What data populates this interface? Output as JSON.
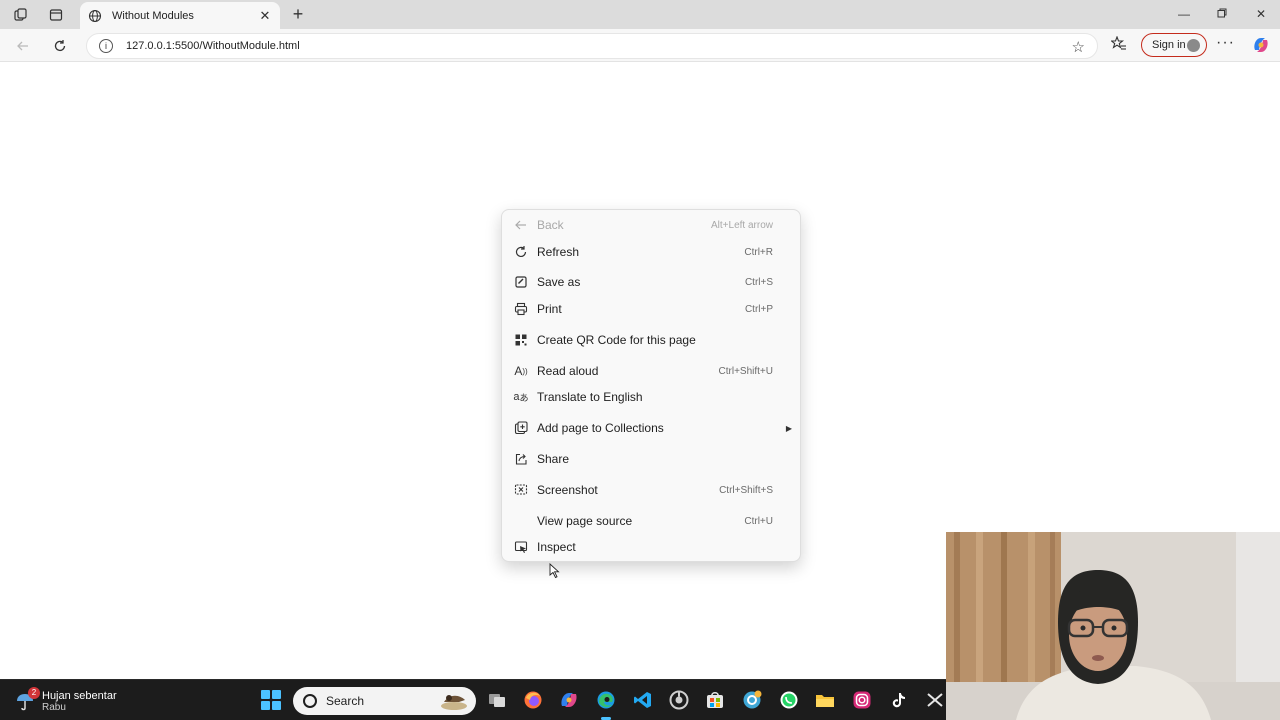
{
  "browser": {
    "tab": {
      "title": "Without Modules"
    },
    "address_bar": {
      "url": "127.0.0.1:5500/WithoutModule.html"
    },
    "sign_in_label": "Sign in"
  },
  "context_menu": {
    "items": [
      {
        "icon": "arrow-left-icon",
        "label": "Back",
        "shortcut": "Alt+Left arrow",
        "enabled": false
      },
      {
        "icon": "refresh-icon",
        "label": "Refresh",
        "shortcut": "Ctrl+R",
        "enabled": true
      },
      {
        "icon": "save-as-icon",
        "label": "Save as",
        "shortcut": "Ctrl+S",
        "enabled": true
      },
      {
        "icon": "print-icon",
        "label": "Print",
        "shortcut": "Ctrl+P",
        "enabled": true
      },
      {
        "icon": "qr-code-icon",
        "label": "Create QR Code for this page",
        "shortcut": "",
        "enabled": true
      },
      {
        "icon": "read-aloud-icon",
        "label": "Read aloud",
        "shortcut": "Ctrl+Shift+U",
        "enabled": true
      },
      {
        "icon": "translate-icon",
        "label": "Translate to English",
        "shortcut": "",
        "enabled": true
      },
      {
        "icon": "collections-icon",
        "label": "Add page to Collections",
        "shortcut": "",
        "enabled": true,
        "submenu": true
      },
      {
        "icon": "share-icon",
        "label": "Share",
        "shortcut": "",
        "enabled": true
      },
      {
        "icon": "screenshot-icon",
        "label": "Screenshot",
        "shortcut": "Ctrl+Shift+S",
        "enabled": true
      },
      {
        "icon": "",
        "label": "View page source",
        "shortcut": "Ctrl+U",
        "enabled": true
      },
      {
        "icon": "inspect-icon",
        "label": "Inspect",
        "shortcut": "",
        "enabled": true
      }
    ]
  },
  "taskbar": {
    "weather": {
      "title": "Hujan sebentar",
      "subtitle": "Rabu",
      "badge": "2"
    },
    "search_placeholder": "Search",
    "pinned": [
      "file-explorer-icon",
      "firefox-icon",
      "copilot-icon",
      "edge-icon",
      "vscode-icon",
      "chrome-icon",
      "store-icon",
      "chatgpt-icon",
      "whatsapp-icon",
      "folder-icon",
      "instagram-icon",
      "tiktok-icon",
      "capcut-icon"
    ]
  },
  "colors": {
    "accent": "#4cc2ff",
    "signin_border": "#c42b1c",
    "taskbar_bg": "#1c1c1c",
    "menu_bg": "#f9f9f9"
  }
}
